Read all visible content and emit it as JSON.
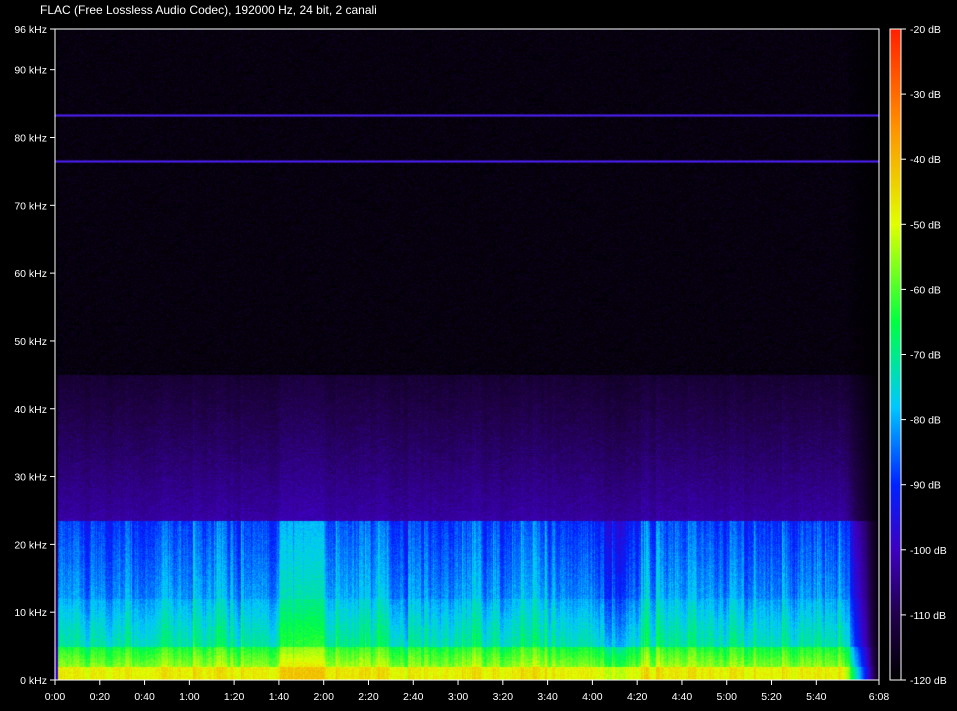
{
  "title": "FLAC (Free Lossless Audio Codec), 192000 Hz, 24 bit, 2 canali",
  "chart_data": {
    "type": "heatmap",
    "title": "FLAC (Free Lossless Audio Codec), 192000 Hz, 24 bit, 2 canali",
    "x_axis": {
      "ticks": [
        "0:00",
        "0:20",
        "0:40",
        "1:00",
        "1:20",
        "1:40",
        "2:00",
        "2:20",
        "2:40",
        "3:00",
        "3:20",
        "3:40",
        "4:00",
        "4:20",
        "4:40",
        "5:00",
        "5:20",
        "5:40",
        "6:08"
      ],
      "tick_seconds": [
        0,
        20,
        40,
        60,
        80,
        100,
        120,
        140,
        160,
        180,
        200,
        220,
        240,
        260,
        280,
        300,
        320,
        340,
        368
      ],
      "range_seconds": [
        0,
        368
      ]
    },
    "y_axis": {
      "ticks": [
        "0 kHz",
        "10 kHz",
        "20 kHz",
        "30 kHz",
        "40 kHz",
        "50 kHz",
        "60 kHz",
        "70 kHz",
        "80 kHz",
        "90 kHz",
        "96 kHz"
      ],
      "tick_khz": [
        0,
        10,
        20,
        30,
        40,
        50,
        60,
        70,
        80,
        90,
        96
      ],
      "range_khz": [
        0,
        96
      ]
    },
    "color_scale": {
      "ticks": [
        "-20 dB",
        "-30 dB",
        "-40 dB",
        "-50 dB",
        "-60 dB",
        "-70 dB",
        "-80 dB",
        "-90 dB",
        "-100 dB",
        "-110 dB",
        "-120 dB"
      ],
      "tick_db": [
        -20,
        -30,
        -40,
        -50,
        -60,
        -70,
        -80,
        -90,
        -100,
        -110,
        -120
      ],
      "range_db": [
        -120,
        -20
      ],
      "colors": [
        "#000000",
        "#20004a",
        "#3d00c0",
        "#0022ff",
        "#00c8ff",
        "#00ff40",
        "#e0ff00",
        "#ff9000",
        "#ff2000"
      ]
    },
    "tones_khz": [
      83.3,
      76.6
    ],
    "grid": false
  }
}
